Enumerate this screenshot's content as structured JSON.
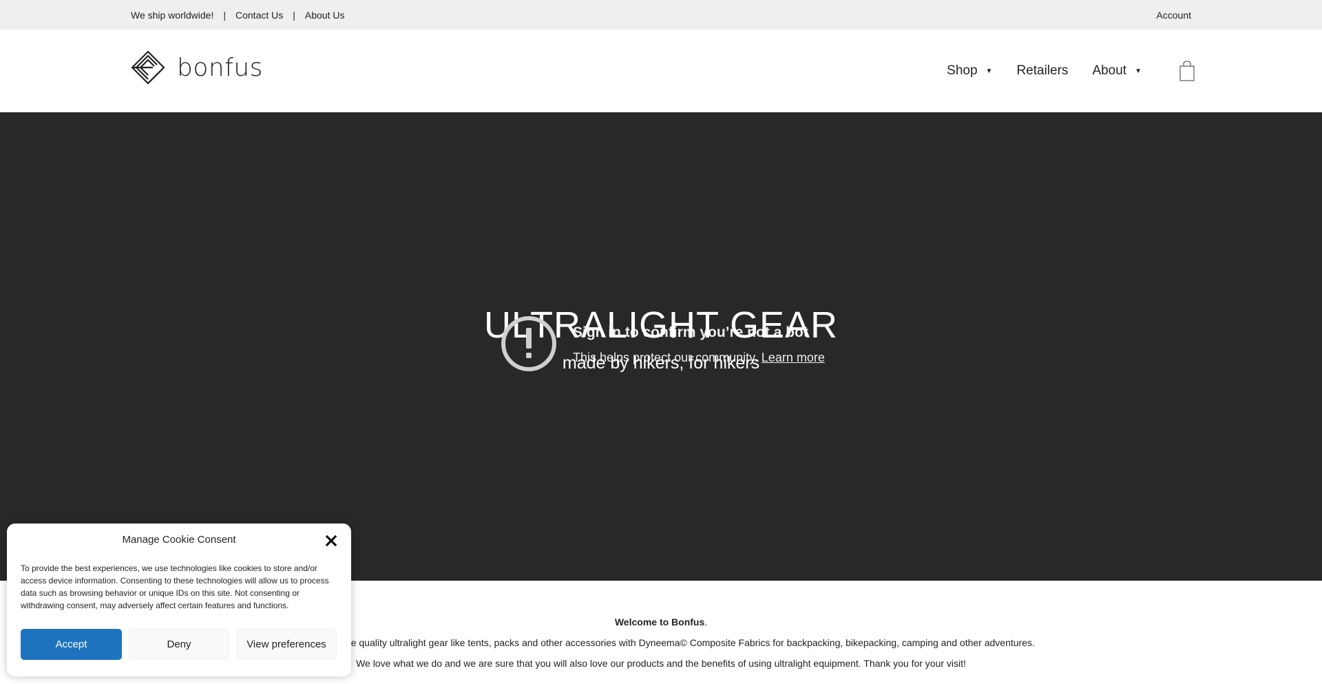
{
  "topbar": {
    "ship_text": "We ship worldwide!",
    "separator": "|",
    "contact_label": "Contact Us",
    "about_label": "About Us",
    "account_label": "Account"
  },
  "header": {
    "logo_text": "bonfus",
    "nav": {
      "shop": "Shop",
      "retailers": "Retailers",
      "about": "About",
      "caret": "▼"
    }
  },
  "hero": {
    "title": "ULTRALIGHT GEAR",
    "subtitle": "made by hikers, for hikers",
    "bot_title": "Sign in to confirm you’re not a bot",
    "bot_desc": "This helps protect our community.",
    "learn_more": "Learn more"
  },
  "welcome": {
    "line1_bold": "Welcome to Bonfus",
    "line1_end": ".",
    "line2": "ho aim to create quality ultralight gear like tents, packs and other accessories with Dyneema© Composite Fabrics for backpacking, bikepacking, camping and other adventures.",
    "line3": "We love what we do and we are sure that you will also love our products and the benefits of using ultralight equipment. Thank you for your visit!"
  },
  "cookie": {
    "title": "Manage Cookie Consent",
    "text": "To provide the best experiences, we use technologies like cookies to store and/or access device information. Consenting to these technologies will allow us to process data such as browsing behavior or unique IDs on this site. Not consenting or withdrawing consent, may adversely affect certain features and functions.",
    "accept": "Accept",
    "deny": "Deny",
    "preferences": "View preferences"
  },
  "colors": {
    "accent": "#1e73be",
    "hero_bg": "#282828",
    "topbar_bg": "#efefef"
  },
  "icons": {
    "logo": "bonfus-diamond-logo",
    "cart": "shopping-bag-icon",
    "alert": "exclamation-circle-icon",
    "close": "close-x-icon"
  }
}
